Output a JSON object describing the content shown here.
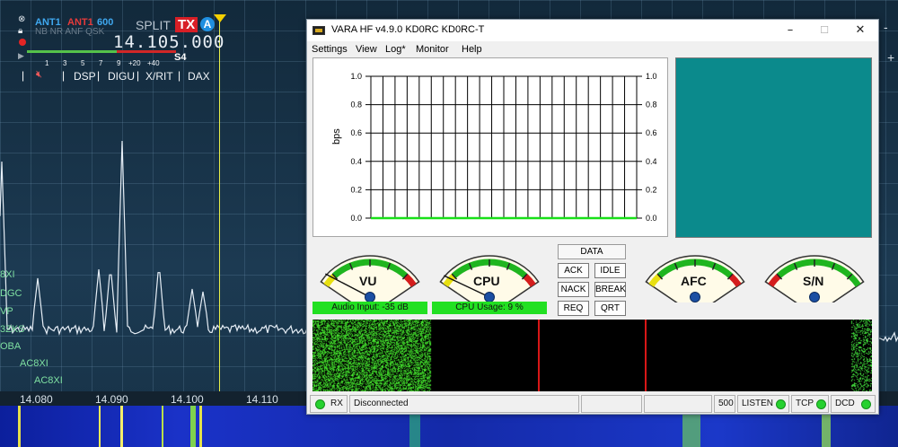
{
  "sdr": {
    "slice": {
      "ant_rx": "ANT1",
      "ant_tx": "ANT1",
      "bandwidth": "600",
      "modes": "NB NR ANF QSK",
      "split_label": "SPLIT",
      "tx_label": "TX",
      "slice_letter": "A",
      "frequency": "14.105.000",
      "s_scale": [
        "1",
        "3",
        "5",
        "7",
        "9",
        "+20",
        "+40"
      ],
      "s_reading": "S4",
      "buttons": [
        "DSP",
        "DIGU",
        "X/RIT",
        "DAX"
      ]
    },
    "freq_ticks": [
      "14.080",
      "14.090",
      "14.100",
      "14.110"
    ],
    "spots": [
      "8XI",
      "DGC",
      "VP",
      "3ZKS",
      "OBA",
      "AC8XI",
      "AC8XI"
    ],
    "side_buttons": [
      "-",
      "+"
    ],
    "colors": {
      "vfo_marker": "#e7ee4a",
      "tx_badge": "#d81f26",
      "slice_badge": "#1f8fe0"
    }
  },
  "vara": {
    "title": "VARA HF v4.9.0     KD0RC  KD0RC-T",
    "window_buttons": {
      "minimize": "–",
      "maximize": "☐",
      "close": "✕"
    },
    "menu": [
      "Settings",
      "View",
      "Log*",
      "Monitor",
      "Help"
    ],
    "chart_data": {
      "type": "line",
      "title": "",
      "xlabel": "",
      "ylabel": "bps",
      "ylim": [
        0,
        1.0
      ],
      "y_ticks": [
        "1.0",
        "0.8",
        "0.6",
        "0.4",
        "0.2",
        "0.0"
      ],
      "grid": true,
      "series": [
        {
          "values": [
            0,
            0,
            0,
            0,
            0,
            0,
            0,
            0,
            0,
            0,
            0,
            0,
            0,
            0,
            0,
            0,
            0,
            0,
            0,
            0,
            0,
            0
          ]
        }
      ],
      "line_color": "#18e018"
    },
    "meters": {
      "vu": {
        "title": "VU",
        "readout": "Audio Input: -35 dB",
        "needle_fraction": 0.12
      },
      "cpu": {
        "title": "CPU",
        "readout": "CPU Usage: 9 %",
        "needle_fraction": 0.1
      },
      "afc": {
        "title": "AFC"
      },
      "sn": {
        "title": "S/N"
      }
    },
    "controls": {
      "data": "DATA",
      "ack": "ACK",
      "idle": "IDLE",
      "nack": "NACK",
      "break": "BREAK",
      "req": "REQ",
      "qrt": "QRT"
    },
    "status": {
      "rx": "RX",
      "connection": "Disconnected",
      "bandwidth": "500",
      "listen": "LISTEN",
      "tcp": "TCP",
      "dcd": "DCD"
    },
    "colors": {
      "scope_bg": "#0b8a8c",
      "led_green": "#26d12f",
      "readout_green": "#22e022"
    }
  }
}
